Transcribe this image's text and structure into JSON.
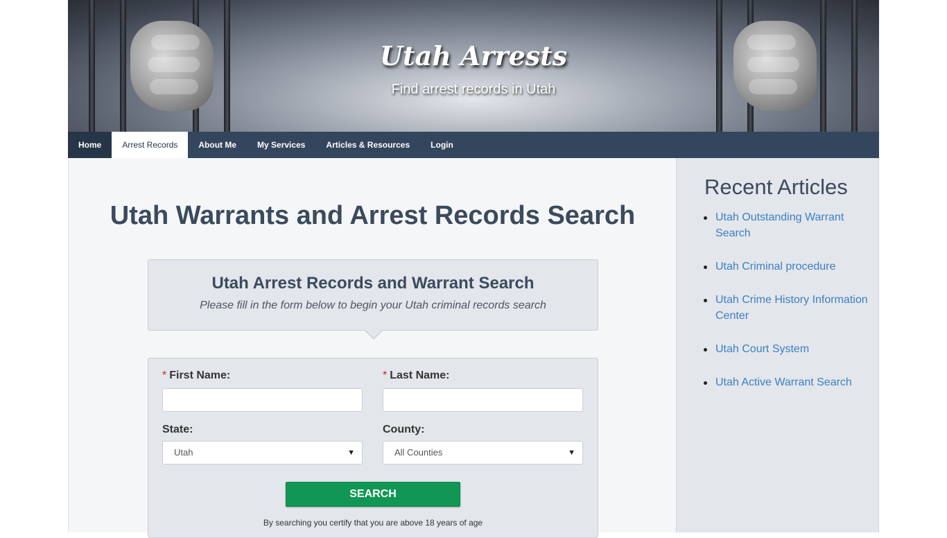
{
  "header": {
    "site_title": "Utah Arrests",
    "tagline": "Find arrest records in Utah"
  },
  "nav": {
    "items": [
      {
        "label": "Home"
      },
      {
        "label": "Arrest Records"
      },
      {
        "label": "About Me"
      },
      {
        "label": "My Services"
      },
      {
        "label": "Articles & Resources"
      },
      {
        "label": "Login"
      }
    ],
    "active": "Arrest Records"
  },
  "main": {
    "page_title": "Utah Warrants and Arrest Records Search",
    "search_box": {
      "title": "Utah Arrest Records and Warrant Search",
      "subtitle": "Please fill in the form below to begin your Utah criminal records search"
    },
    "form": {
      "required_mark": "*",
      "first_name_label": "First Name:",
      "first_name_value": "",
      "last_name_label": "Last Name:",
      "last_name_value": "",
      "state_label": "State:",
      "state_value": "Utah",
      "county_label": "County:",
      "county_value": "All Counties",
      "search_button": "SEARCH",
      "disclaimer": "By searching you certify that you are above 18 years of age"
    }
  },
  "sidebar": {
    "heading": "Recent Articles",
    "articles": [
      "Utah Outstanding Warrant Search",
      "Utah Criminal procedure",
      "Utah Crime History Information Center",
      "Utah Court System",
      "Utah Active Warrant Search"
    ]
  },
  "icons": {
    "select_arrow": "chevron-down-icon",
    "list_bullet": "bullet-dot-icon"
  },
  "colors": {
    "nav_bg": "#34465e",
    "title_text": "#3b4a5e",
    "link": "#3c7fc4",
    "search_button": "#119755",
    "required": "#cc2222"
  }
}
